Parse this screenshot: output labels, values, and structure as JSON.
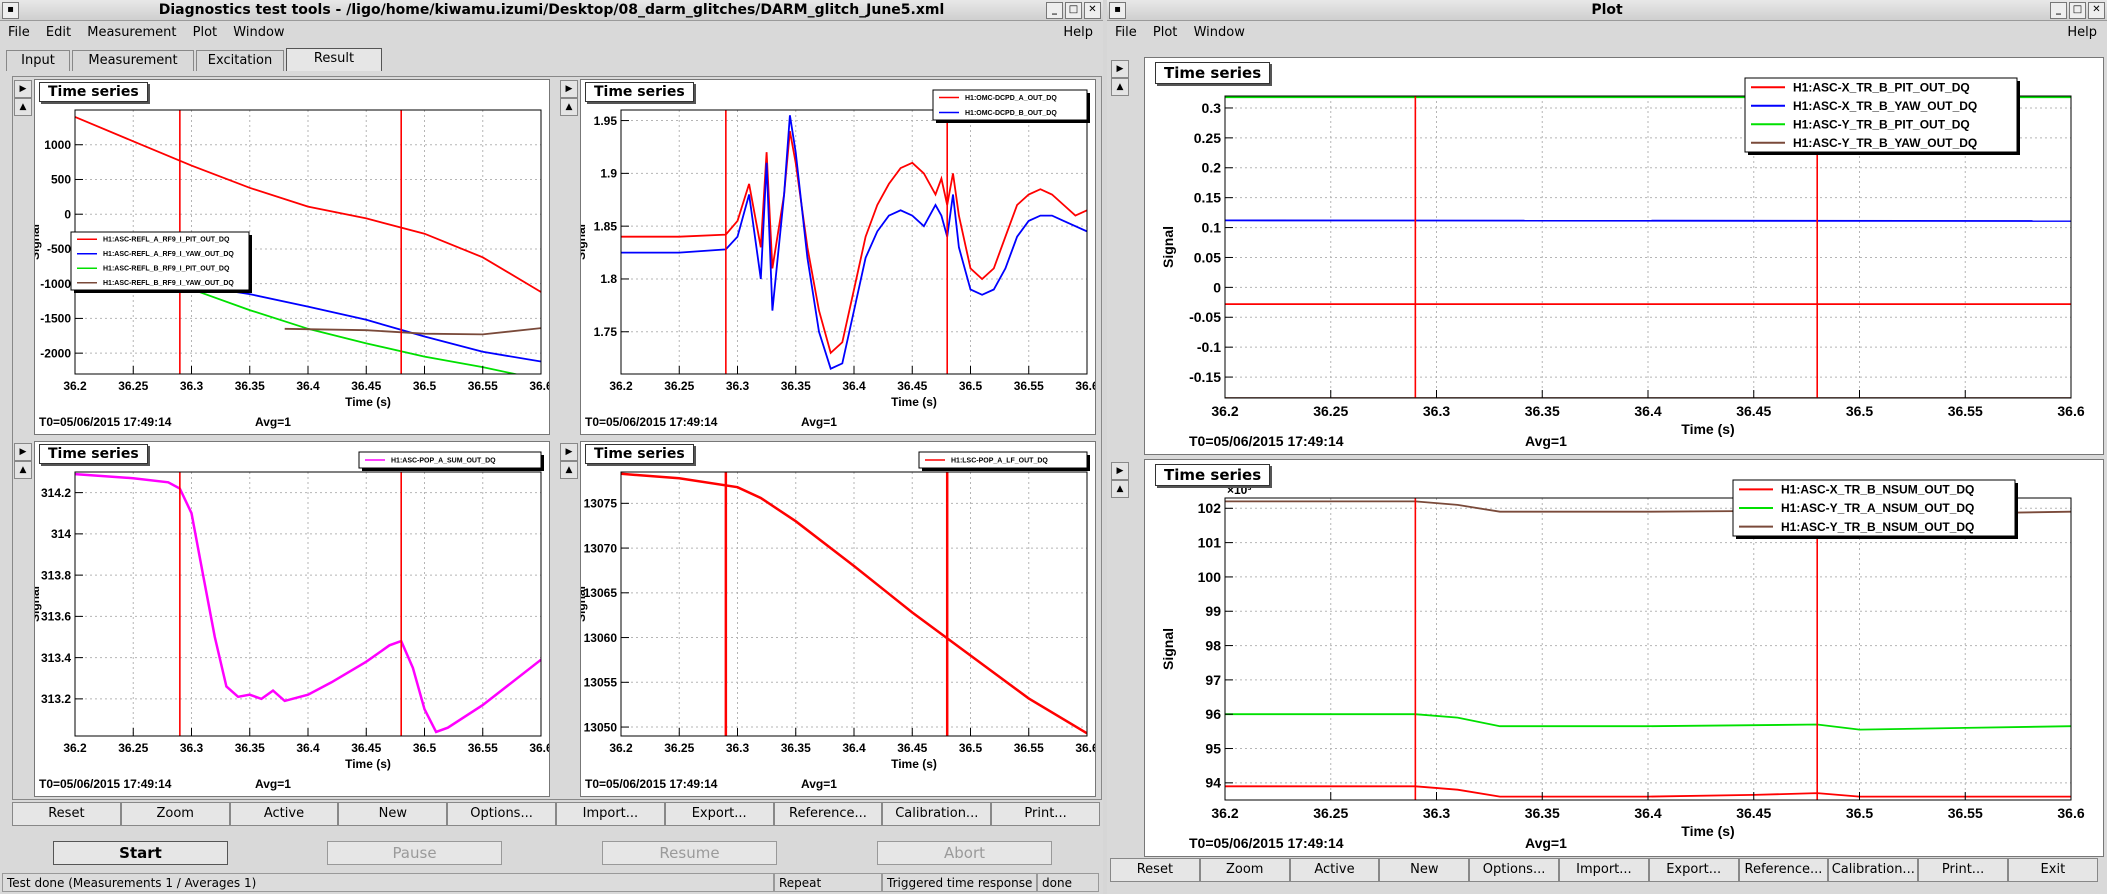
{
  "left_window": {
    "title": "Diagnostics test tools - /ligo/home/kiwamu.izumi/Desktop/08_darm_glitches/DARM_glitch_June5.xml",
    "menu": [
      "File",
      "Edit",
      "Measurement",
      "Plot",
      "Window"
    ],
    "help": "Help",
    "tabs": [
      "Input",
      "Measurement",
      "Excitation",
      "Result"
    ],
    "active_tab": "Result",
    "buttons": [
      "Reset",
      "Zoom",
      "Active",
      "New",
      "Options...",
      "Import...",
      "Export...",
      "Reference...",
      "Calibration...",
      "Print..."
    ],
    "controls": {
      "start": "Start",
      "pause": "Pause",
      "resume": "Resume",
      "abort": "Abort"
    },
    "status": {
      "msg": "Test done (Measurements 1 / Averages 1)",
      "repeat": "Repeat",
      "trigger": "Triggered time response",
      "done": "done"
    }
  },
  "right_window": {
    "title": "Plot",
    "menu": [
      "File",
      "Plot",
      "Window"
    ],
    "help": "Help",
    "buttons": [
      "Reset",
      "Zoom",
      "Active",
      "New",
      "Options...",
      "Import...",
      "Export...",
      "Reference...",
      "Calibration...",
      "Print...",
      "Exit"
    ]
  },
  "colors": {
    "red": "#ff0000",
    "blue": "#0000ff",
    "green": "#00e000",
    "brown": "#7a4a3a",
    "magenta": "#ff00ff"
  },
  "chart_data": [
    {
      "id": "p1",
      "type": "line",
      "title": "Time series",
      "xlabel": "Time (s)",
      "ylabel": "Signal",
      "xlim": [
        36.2,
        36.6
      ],
      "ylim": [
        -2300,
        1500
      ],
      "xticks": [
        36.2,
        36.25,
        36.3,
        36.35,
        36.4,
        36.45,
        36.5,
        36.55,
        36.6
      ],
      "yticks": [
        -2000,
        -1500,
        -1000,
        -500,
        0,
        500,
        1000
      ],
      "vlines": [
        36.29,
        36.48
      ],
      "footer": {
        "t0": "T0=05/06/2015 17:49:14",
        "avg": "Avg=1"
      },
      "legend": {
        "position": "bottom-left"
      },
      "series": [
        {
          "name": "H1:ASC-REFL_A_RF9_I_PIT_OUT_DQ",
          "color": "#ff0000",
          "x": [
            36.2,
            36.25,
            36.3,
            36.35,
            36.4,
            36.45,
            36.5,
            36.55,
            36.6
          ],
          "y": [
            1400,
            1050,
            700,
            380,
            110,
            -60,
            -280,
            -620,
            -1120
          ]
        },
        {
          "name": "H1:ASC-REFL_A_RF9_I_YAW_OUT_DQ",
          "color": "#0000ff",
          "x": [
            36.2,
            36.25,
            36.3,
            36.35,
            36.4,
            36.45,
            36.5,
            36.55,
            36.6
          ],
          "y": [
            -820,
            -960,
            -1020,
            -1150,
            -1330,
            -1520,
            -1760,
            -1980,
            -2120
          ]
        },
        {
          "name": "H1:ASC-REFL_B_RF9_I_PIT_OUT_DQ",
          "color": "#00e000",
          "x": [
            36.2,
            36.25,
            36.3,
            36.35,
            36.4,
            36.45,
            36.5,
            36.55,
            36.6
          ],
          "y": [
            -480,
            -800,
            -1080,
            -1380,
            -1650,
            -1860,
            -2050,
            -2200,
            -2380
          ]
        },
        {
          "name": "H1:ASC-REFL_B_RF9_I_YAW_OUT_DQ",
          "color": "#7a4a3a",
          "x": [
            36.38,
            36.45,
            36.5,
            36.55,
            36.6
          ],
          "y": [
            -1650,
            -1670,
            -1720,
            -1730,
            -1640
          ]
        }
      ]
    },
    {
      "id": "p2",
      "type": "line",
      "title": "Time series",
      "xlabel": "Time (s)",
      "ylabel": "Signal",
      "xlim": [
        36.2,
        36.6
      ],
      "ylim": [
        1.71,
        1.96
      ],
      "xticks": [
        36.2,
        36.25,
        36.3,
        36.35,
        36.4,
        36.45,
        36.5,
        36.55,
        36.6
      ],
      "yticks": [
        1.75,
        1.8,
        1.85,
        1.9,
        1.95
      ],
      "vlines": [
        36.29,
        36.48
      ],
      "footer": {
        "t0": "T0=05/06/2015 17:49:14",
        "avg": "Avg=1"
      },
      "legend": {
        "position": "top-right"
      },
      "series": [
        {
          "name": "H1:OMC-DCPD_A_OUT_DQ",
          "color": "#ff0000",
          "x": [
            36.2,
            36.25,
            36.29,
            36.3,
            36.31,
            36.32,
            36.325,
            36.33,
            36.34,
            36.345,
            36.35,
            36.36,
            36.37,
            36.38,
            36.39,
            36.4,
            36.41,
            36.42,
            36.43,
            36.44,
            36.45,
            36.46,
            36.47,
            36.475,
            36.48,
            36.485,
            36.49,
            36.5,
            36.51,
            36.52,
            36.53,
            36.54,
            36.55,
            36.56,
            36.57,
            36.58,
            36.59,
            36.6
          ],
          "y": [
            1.84,
            1.84,
            1.842,
            1.855,
            1.89,
            1.83,
            1.92,
            1.81,
            1.88,
            1.94,
            1.91,
            1.83,
            1.77,
            1.73,
            1.74,
            1.79,
            1.84,
            1.87,
            1.89,
            1.905,
            1.91,
            1.9,
            1.88,
            1.895,
            1.87,
            1.9,
            1.86,
            1.81,
            1.8,
            1.81,
            1.84,
            1.87,
            1.88,
            1.885,
            1.88,
            1.87,
            1.86,
            1.865
          ]
        },
        {
          "name": "H1:OMC-DCPD_B_OUT_DQ",
          "color": "#0000ff",
          "x": [
            36.2,
            36.25,
            36.29,
            36.3,
            36.31,
            36.32,
            36.325,
            36.33,
            36.34,
            36.345,
            36.35,
            36.36,
            36.37,
            36.38,
            36.39,
            36.4,
            36.41,
            36.42,
            36.43,
            36.44,
            36.45,
            36.46,
            36.47,
            36.475,
            36.48,
            36.485,
            36.49,
            36.5,
            36.51,
            36.52,
            36.53,
            36.54,
            36.55,
            36.56,
            36.57,
            36.58,
            36.59,
            36.6
          ],
          "y": [
            1.825,
            1.825,
            1.828,
            1.84,
            1.88,
            1.8,
            1.91,
            1.77,
            1.88,
            1.955,
            1.92,
            1.82,
            1.75,
            1.715,
            1.72,
            1.77,
            1.82,
            1.845,
            1.86,
            1.865,
            1.86,
            1.85,
            1.87,
            1.86,
            1.84,
            1.88,
            1.83,
            1.79,
            1.785,
            1.79,
            1.81,
            1.84,
            1.855,
            1.86,
            1.86,
            1.855,
            1.85,
            1.845
          ]
        }
      ]
    },
    {
      "id": "p3",
      "type": "line",
      "title": "Time series",
      "xlabel": "Time (s)",
      "ylabel": "Signal",
      "xlim": [
        36.2,
        36.6
      ],
      "ylim": [
        313.02,
        314.3
      ],
      "xticks": [
        36.2,
        36.25,
        36.3,
        36.35,
        36.4,
        36.45,
        36.5,
        36.55,
        36.6
      ],
      "yticks": [
        313.2,
        313.4,
        313.6,
        313.8,
        314,
        314.2
      ],
      "vlines": [
        36.29,
        36.48
      ],
      "footer": {
        "t0": "T0=05/06/2015 17:49:14",
        "avg": "Avg=1"
      },
      "legend": {
        "position": "top-right"
      },
      "series": [
        {
          "name": "H1:ASC-POP_A_SUM_OUT_DQ",
          "color": "#ff00ff",
          "x": [
            36.2,
            36.25,
            36.28,
            36.29,
            36.3,
            36.31,
            36.32,
            36.33,
            36.34,
            36.35,
            36.36,
            36.37,
            36.38,
            36.4,
            36.42,
            36.45,
            36.47,
            36.48,
            36.49,
            36.5,
            36.51,
            36.52,
            36.55,
            36.6
          ],
          "y": [
            314.29,
            314.27,
            314.25,
            314.22,
            314.1,
            313.8,
            313.5,
            313.26,
            313.21,
            313.22,
            313.2,
            313.24,
            313.19,
            313.22,
            313.28,
            313.38,
            313.46,
            313.48,
            313.35,
            313.15,
            313.04,
            313.06,
            313.17,
            313.39
          ]
        }
      ]
    },
    {
      "id": "p4",
      "type": "line",
      "title": "Time series",
      "xlabel": "Time (s)",
      "ylabel": "Signal",
      "xlim": [
        36.2,
        36.6
      ],
      "ylim": [
        13049,
        13078.5
      ],
      "xticks": [
        36.2,
        36.25,
        36.3,
        36.35,
        36.4,
        36.45,
        36.5,
        36.55,
        36.6
      ],
      "yticks": [
        13050,
        13055,
        13060,
        13065,
        13070,
        13075
      ],
      "vlines": [
        36.29,
        36.48
      ],
      "footer": {
        "t0": "T0=05/06/2015 17:49:14",
        "avg": "Avg=1"
      },
      "legend": {
        "position": "top-right"
      },
      "series": [
        {
          "name": "H1:LSC-POP_A_LF_OUT_DQ",
          "color": "#ff0000",
          "x": [
            36.2,
            36.25,
            36.3,
            36.32,
            36.35,
            36.4,
            36.45,
            36.5,
            36.55,
            36.6
          ],
          "y": [
            13078.3,
            13077.8,
            13076.8,
            13075.6,
            13073.0,
            13068.0,
            13062.8,
            13058.0,
            13053.2,
            13049.3
          ]
        }
      ]
    },
    {
      "id": "p5",
      "type": "line",
      "title": "Time series",
      "xlabel": "Time (s)",
      "ylabel": "Signal",
      "xlim": [
        36.2,
        36.6
      ],
      "ylim": [
        -0.185,
        0.32
      ],
      "xticks": [
        36.2,
        36.25,
        36.3,
        36.35,
        36.4,
        36.45,
        36.5,
        36.55,
        36.6
      ],
      "yticks": [
        -0.15,
        -0.1,
        -0.05,
        0,
        0.05,
        0.1,
        0.15,
        0.2,
        0.25,
        0.3
      ],
      "vlines": [
        36.29,
        36.48
      ],
      "footer": {
        "t0": "T0=05/06/2015 17:49:14",
        "avg": "Avg=1"
      },
      "legend": {
        "position": "top-right"
      },
      "series": [
        {
          "name": "H1:ASC-X_TR_B_PIT_OUT_DQ",
          "color": "#ff0000",
          "x": [
            36.2,
            36.6
          ],
          "y": [
            -0.028,
            -0.028
          ]
        },
        {
          "name": "H1:ASC-X_TR_B_YAW_OUT_DQ",
          "color": "#0000ff",
          "x": [
            36.2,
            36.6
          ],
          "y": [
            0.112,
            0.111
          ]
        },
        {
          "name": "H1:ASC-Y_TR_B_PIT_OUT_DQ",
          "color": "#00e000",
          "x": [
            36.2,
            36.6
          ],
          "y": [
            0.318,
            0.318
          ]
        },
        {
          "name": "H1:ASC-Y_TR_B_YAW_OUT_DQ",
          "color": "#7a4a3a",
          "x": [
            36.2,
            36.6
          ],
          "y": [
            -0.185,
            -0.185
          ]
        }
      ]
    },
    {
      "id": "p6",
      "type": "line",
      "title": "Time series",
      "xlabel": "Time (s)",
      "ylabel": "Signal",
      "yexp": "×10³",
      "xlim": [
        36.2,
        36.6
      ],
      "ylim": [
        93.5,
        102.3
      ],
      "xticks": [
        36.2,
        36.25,
        36.3,
        36.35,
        36.4,
        36.45,
        36.5,
        36.55,
        36.6
      ],
      "yticks": [
        94,
        95,
        96,
        97,
        98,
        99,
        100,
        101,
        102
      ],
      "vlines": [
        36.29,
        36.48
      ],
      "footer": {
        "t0": "T0=05/06/2015 17:49:14",
        "avg": "Avg=1"
      },
      "legend": {
        "position": "top-right"
      },
      "series": [
        {
          "name": "H1:ASC-X_TR_B_NSUM_OUT_DQ",
          "color": "#ff0000",
          "x": [
            36.2,
            36.29,
            36.31,
            36.33,
            36.4,
            36.45,
            36.48,
            36.5,
            36.55,
            36.6
          ],
          "y": [
            93.9,
            93.9,
            93.8,
            93.6,
            93.6,
            93.65,
            93.7,
            93.6,
            93.6,
            93.6
          ]
        },
        {
          "name": "H1:ASC-Y_TR_A_NSUM_OUT_DQ",
          "color": "#00e000",
          "x": [
            36.2,
            36.29,
            36.31,
            36.33,
            36.4,
            36.45,
            36.48,
            36.5,
            36.55,
            36.6
          ],
          "y": [
            96.0,
            96.0,
            95.9,
            95.65,
            95.65,
            95.68,
            95.7,
            95.55,
            95.6,
            95.65
          ]
        },
        {
          "name": "H1:ASC-Y_TR_B_NSUM_OUT_DQ",
          "color": "#7a4a3a",
          "x": [
            36.2,
            36.29,
            36.31,
            36.33,
            36.4,
            36.45,
            36.48,
            36.5,
            36.55,
            36.6
          ],
          "y": [
            102.2,
            102.2,
            102.1,
            101.9,
            101.9,
            101.92,
            101.95,
            101.85,
            101.85,
            101.9
          ]
        }
      ]
    }
  ]
}
